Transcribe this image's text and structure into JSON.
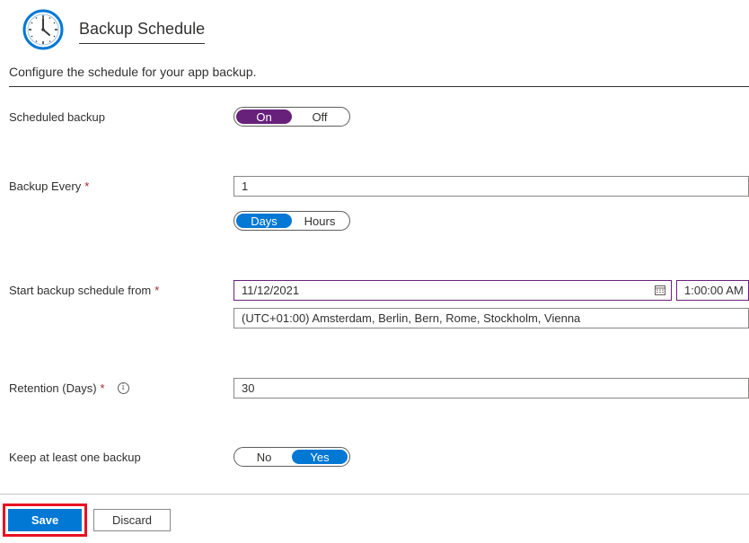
{
  "header": {
    "title": "Backup Schedule",
    "icon": "clock-icon"
  },
  "description": "Configure the schedule for your app backup.",
  "scheduled_backup": {
    "label": "Scheduled backup",
    "options": [
      "On",
      "Off"
    ],
    "selected": "On"
  },
  "backup_every": {
    "label": "Backup Every",
    "required": "*",
    "value": "1",
    "unit_options": [
      "Days",
      "Hours"
    ],
    "unit_selected": "Days"
  },
  "start_schedule": {
    "label": "Start backup schedule from",
    "required": "*",
    "date": "11/12/2021",
    "time": "1:00:00 AM",
    "timezone": "(UTC+01:00) Amsterdam, Berlin, Bern, Rome, Stockholm, Vienna"
  },
  "retention": {
    "label": "Retention (Days)",
    "required": "*",
    "info": "i",
    "value": "30"
  },
  "keep_one": {
    "label": "Keep at least one backup",
    "options": [
      "No",
      "Yes"
    ],
    "selected": "Yes"
  },
  "footer": {
    "save_label": "Save",
    "discard_label": "Discard"
  },
  "colors": {
    "accent_purple": "#68217a",
    "primary_blue": "#0078d4",
    "highlight_red": "#e81123",
    "required_red": "#a4262c"
  }
}
